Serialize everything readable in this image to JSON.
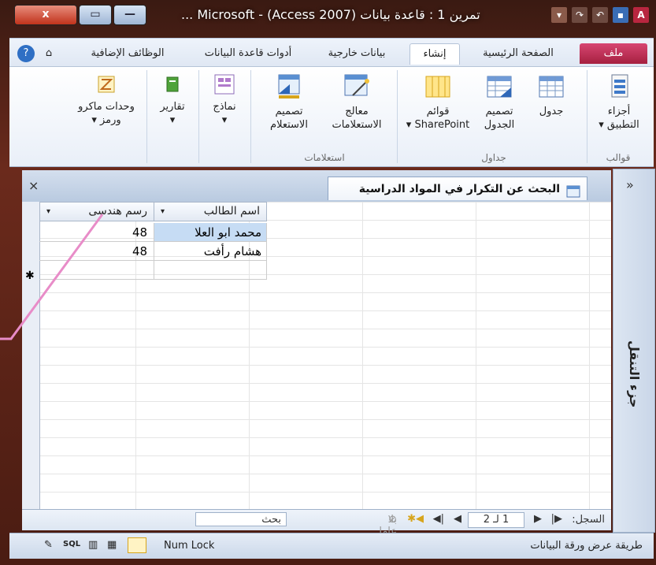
{
  "window": {
    "title": "تمرين 1 : قاعدة بيانات (Access 2007) - Microsoft ...",
    "close_label": "x",
    "app_icon_letter": "A"
  },
  "tabs": {
    "file": "ملف",
    "home": "الصفحة الرئيسية",
    "create": "إنشاء",
    "external": "بيانات خارجية",
    "dbtools": "أدوات قاعدة البيانات",
    "addins": "الوظائف الإضافية"
  },
  "ribbon": {
    "app_parts": "أجزاء التطبيق",
    "table": "جدول",
    "table_design": "تصميم الجدول",
    "sp_lists": "قوائم SharePoint",
    "query_wizard": "معالج الاستعلامات",
    "query_design": "تصميم الاستعلام",
    "forms": "نماذج",
    "reports": "تقارير",
    "macros": "وحدات ماكرو ورمز",
    "group_templates": "قوالب",
    "group_tables": "جداول",
    "group_queries": "استعلامات"
  },
  "nav_pane": {
    "label": "جزء التنقل",
    "chevron": "»"
  },
  "document": {
    "tab_title": "البحث عن التكرار في المواد الدراسية",
    "close": "×"
  },
  "datasheet": {
    "columns": [
      "اسم الطالب",
      "رسم هندسى"
    ],
    "rows": [
      {
        "student": "محمد ابو العلا",
        "drawing": "48"
      },
      {
        "student": "هشام رأفت",
        "drawing": "48"
      }
    ],
    "new_row_marker": "✱"
  },
  "record_nav": {
    "label": "السجل:",
    "position": "1 لـ 2",
    "filter": "بلا عامل تصفية",
    "search": "بحث"
  },
  "status_bar": {
    "view": "طريقة عرض ورقة البيانات",
    "numlock": "Num Lock",
    "sql": "SQL"
  },
  "colors": {
    "accent_file": "#c12c56",
    "frame": "#5a1e14",
    "selected_cell": "#c6dcf4"
  }
}
